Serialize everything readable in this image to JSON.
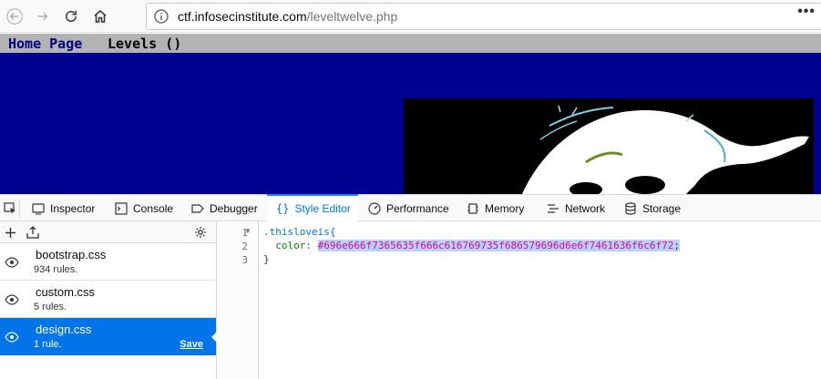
{
  "browser": {
    "url_host": "ctf.infosecinstitute.com",
    "url_path": "/leveltwelve.php",
    "more_label": "•••"
  },
  "page": {
    "nav_home": "Home Page",
    "nav_levels": "Levels ()",
    "colors": {
      "nav_bg": "#b3b3b3",
      "body_bg": "#00008f",
      "home_link": "#000080"
    }
  },
  "devtools": {
    "tabs": [
      {
        "label": "Inspector",
        "icon": "inspector-icon"
      },
      {
        "label": "Console",
        "icon": "console-icon"
      },
      {
        "label": "Debugger",
        "icon": "debugger-icon"
      },
      {
        "label": "Style Editor",
        "icon": "style-editor-icon",
        "selected": true
      },
      {
        "label": "Performance",
        "icon": "performance-icon"
      },
      {
        "label": "Memory",
        "icon": "memory-icon"
      },
      {
        "label": "Network",
        "icon": "network-icon"
      },
      {
        "label": "Storage",
        "icon": "storage-icon"
      }
    ],
    "stylesheets": [
      {
        "name": "bootstrap.css",
        "rules": "934 rules."
      },
      {
        "name": "custom.css",
        "rules": "5 rules."
      },
      {
        "name": "design.css",
        "rules": "1 rule.",
        "selected": true,
        "save_label": "Save"
      }
    ],
    "editor": {
      "line_numbers": [
        "1",
        "2",
        "3"
      ],
      "selector": ".thisloveis{",
      "property": "color: ",
      "value": "#696e666f7365635f666c616769735f686579696d6e6f7461636f6c6f72",
      "semicolon": ";",
      "closing": "}"
    },
    "colors": {
      "accent": "#0074e8",
      "selected_bg": "#0074e8",
      "value_color": "#dd00a9"
    }
  }
}
